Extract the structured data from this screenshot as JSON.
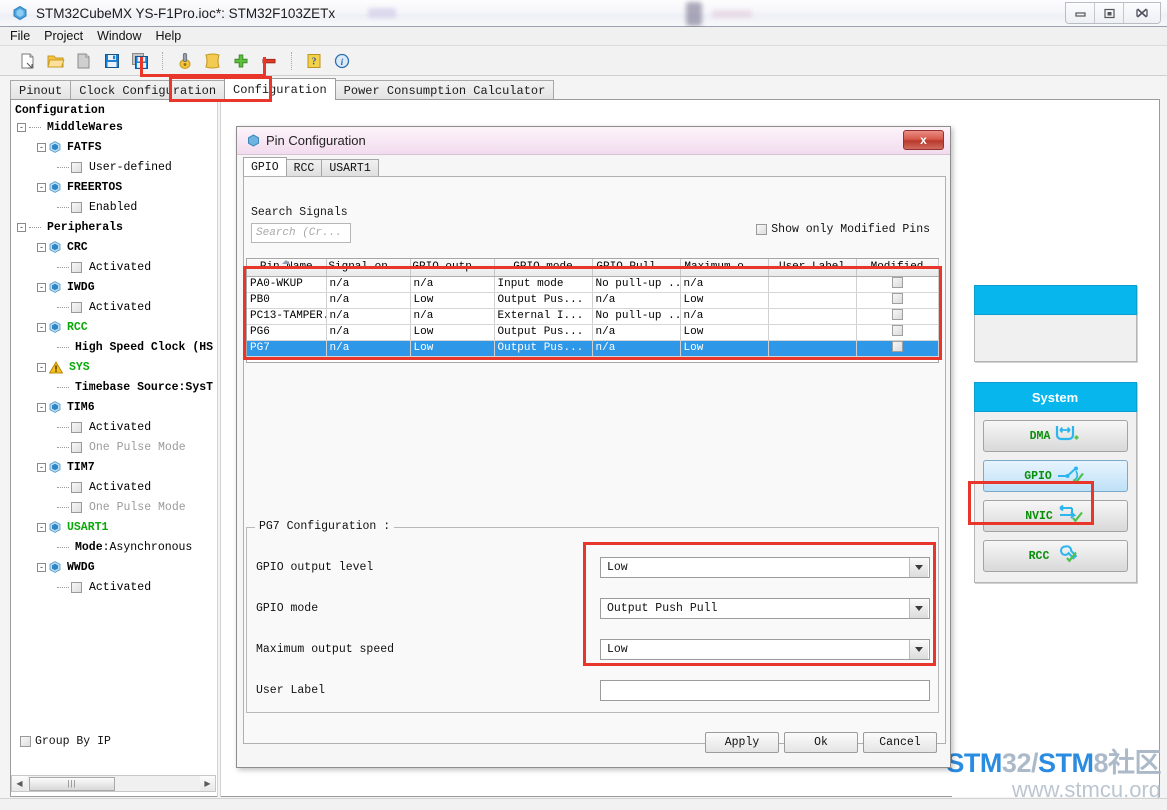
{
  "window": {
    "title": "STM32CubeMX YS-F1Pro.ioc*: STM32F103ZETx",
    "app_icon": "cube-icon",
    "buttons": {
      "minimize": "–",
      "maximize": "▣",
      "close": "✖"
    }
  },
  "menu": {
    "items": [
      "File",
      "Project",
      "Window",
      "Help"
    ]
  },
  "toolbar": {
    "icons": [
      "new-project-icon",
      "open-project-icon",
      "save-as-icon",
      "save-icon",
      "save-all-icon",
      "generate-code-icon",
      "generate-report-icon",
      "add-icon",
      "remove-icon",
      "help-icon",
      "about-icon"
    ]
  },
  "main_tabs": {
    "items": [
      "Pinout",
      "Clock Configuration",
      "Configuration",
      "Power Consumption Calculator"
    ],
    "active": "Configuration"
  },
  "tree": {
    "root": "Configuration",
    "nodes": [
      {
        "label": "MiddleWares",
        "type": "group",
        "indent": 0,
        "expander": "-"
      },
      {
        "label": "FATFS",
        "type": "ip",
        "indent": 1,
        "expander": "-",
        "state": "normal"
      },
      {
        "label": "User-defined",
        "type": "check",
        "indent": 2,
        "state": "normal"
      },
      {
        "label": "FREERTOS",
        "type": "ip",
        "indent": 1,
        "expander": "-",
        "state": "normal"
      },
      {
        "label": "Enabled",
        "type": "check",
        "indent": 2,
        "state": "normal"
      },
      {
        "label": "Peripherals",
        "type": "group",
        "indent": 0,
        "expander": "-"
      },
      {
        "label": "CRC",
        "type": "ip",
        "indent": 1,
        "expander": "-",
        "state": "normal"
      },
      {
        "label": "Activated",
        "type": "check",
        "indent": 2,
        "state": "normal"
      },
      {
        "label": "IWDG",
        "type": "ip",
        "indent": 1,
        "expander": "-",
        "state": "normal"
      },
      {
        "label": "Activated",
        "type": "check",
        "indent": 2,
        "state": "normal"
      },
      {
        "label": "RCC",
        "type": "ip",
        "indent": 1,
        "expander": "-",
        "state": "green"
      },
      {
        "label": "High Speed Clock (HS",
        "type": "text",
        "indent": 2,
        "state": "normal"
      },
      {
        "label": "SYS",
        "type": "warn",
        "indent": 1,
        "expander": "-",
        "state": "green"
      },
      {
        "label": "Timebase Source:SysT",
        "type": "text",
        "indent": 2,
        "state": "normal"
      },
      {
        "label": "TIM6",
        "type": "ip",
        "indent": 1,
        "expander": "-",
        "state": "normal"
      },
      {
        "label": "Activated",
        "type": "check",
        "indent": 2,
        "state": "normal"
      },
      {
        "label": "One Pulse Mode",
        "type": "check",
        "indent": 2,
        "state": "disabled"
      },
      {
        "label": "TIM7",
        "type": "ip",
        "indent": 1,
        "expander": "-",
        "state": "normal"
      },
      {
        "label": "Activated",
        "type": "check",
        "indent": 2,
        "state": "normal"
      },
      {
        "label": "One Pulse Mode",
        "type": "check",
        "indent": 2,
        "state": "disabled"
      },
      {
        "label": "USART1",
        "type": "ip",
        "indent": 1,
        "expander": "-",
        "state": "green"
      },
      {
        "label": "Mode:Asynchronous",
        "type": "text2",
        "indent": 2,
        "state": "normal",
        "bold_prefix": "Mode",
        "rest": ":Asynchronous"
      },
      {
        "label": "WWDG",
        "type": "ip",
        "indent": 1,
        "expander": "-",
        "state": "normal"
      },
      {
        "label": "Activated",
        "type": "check",
        "indent": 2,
        "state": "normal"
      }
    ],
    "hscroll": {
      "left_arrow": "◀",
      "right_arrow": "▶",
      "grip": "|||"
    }
  },
  "dialog": {
    "title": "Pin Configuration",
    "title_icon": "pin-config-icon",
    "close_label": "x",
    "tabs": {
      "items": [
        "GPIO",
        "RCC",
        "USART1"
      ],
      "active": "GPIO"
    },
    "search": {
      "label": "Search Signals",
      "placeholder": "Search (Cr..."
    },
    "show_only_modified": {
      "label": "Show only Modified Pins",
      "checked": false
    },
    "table": {
      "headers": [
        "Pin Name",
        "Signal on...",
        "GPIO outp...",
        "GPIO mode",
        "GPIO Pull...",
        "Maximum o...",
        "User Label",
        "Modified"
      ],
      "sorted_column": "Pin Name",
      "sort_direction": "asc",
      "rows": [
        {
          "pin": "PA0-WKUP",
          "signal": "n/a",
          "output": "n/a",
          "mode": "Input mode",
          "pull": "No pull-up ...",
          "speed": "n/a",
          "user_label": "",
          "modified": false,
          "selected": false
        },
        {
          "pin": "PB0",
          "signal": "n/a",
          "output": "Low",
          "mode": "Output Pus...",
          "pull": "n/a",
          "speed": "Low",
          "user_label": "",
          "modified": false,
          "selected": false
        },
        {
          "pin": "PC13-TAMPER...",
          "signal": "n/a",
          "output": "n/a",
          "mode": "External I...",
          "pull": "No pull-up ...",
          "speed": "n/a",
          "user_label": "",
          "modified": false,
          "selected": false
        },
        {
          "pin": "PG6",
          "signal": "n/a",
          "output": "Low",
          "mode": "Output Pus...",
          "pull": "n/a",
          "speed": "Low",
          "user_label": "",
          "modified": false,
          "selected": false
        },
        {
          "pin": "PG7",
          "signal": "n/a",
          "output": "Low",
          "mode": "Output Pus...",
          "pull": "n/a",
          "speed": "Low",
          "user_label": "",
          "modified": false,
          "selected": true
        }
      ]
    },
    "config": {
      "title": "PG7 Configuration :",
      "fields": [
        {
          "label": "GPIO output level",
          "value": "Low",
          "type": "combo"
        },
        {
          "label": "GPIO mode",
          "value": "Output Push Pull",
          "type": "combo"
        },
        {
          "label": "Maximum output speed",
          "value": "Low",
          "type": "combo"
        },
        {
          "label": "User Label",
          "value": "",
          "type": "text"
        }
      ]
    },
    "footer": {
      "group_by_ip": {
        "label": "Group By IP",
        "checked": false
      },
      "apply": "Apply",
      "ok": "Ok",
      "cancel": "Cancel"
    }
  },
  "ip_panel": {
    "groups": [
      {
        "title": "",
        "buttons": []
      },
      {
        "title": "System",
        "buttons": [
          {
            "label": "DMA",
            "icon": "dma-icon",
            "selected": false,
            "status": "add"
          },
          {
            "label": "GPIO",
            "icon": "gpio-icon",
            "selected": true,
            "status": "ok"
          },
          {
            "label": "NVIC",
            "icon": "nvic-icon",
            "selected": false,
            "status": "ok"
          },
          {
            "label": "RCC",
            "icon": "rcc-wrench-icon",
            "selected": false,
            "status": "ok"
          }
        ]
      }
    ]
  },
  "watermark": {
    "line1_a": "STM",
    "line1_b": "32/",
    "line1_c": "STM",
    "line1_d": "8社区",
    "line2": "www.stmcu.org"
  },
  "colors": {
    "accent_cyan": "#06b6ed",
    "selection_blue": "#2f97e8",
    "highlight_red": "#e8362a",
    "green_text": "#0aa80a",
    "dialog_pink": "#f7e6f3"
  }
}
